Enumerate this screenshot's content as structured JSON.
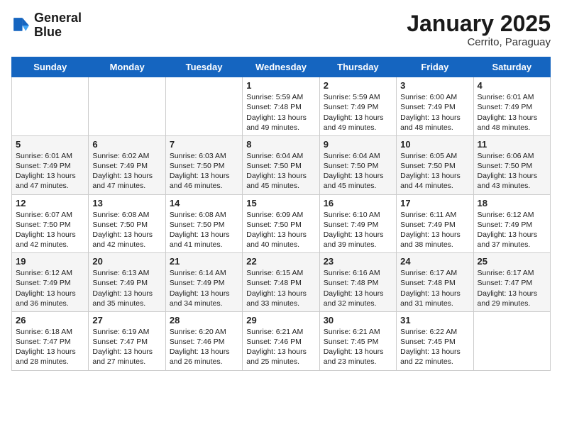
{
  "logo": {
    "line1": "General",
    "line2": "Blue"
  },
  "title": "January 2025",
  "subtitle": "Cerrito, Paraguay",
  "days_header": [
    "Sunday",
    "Monday",
    "Tuesday",
    "Wednesday",
    "Thursday",
    "Friday",
    "Saturday"
  ],
  "weeks": [
    [
      {
        "day": "",
        "content": ""
      },
      {
        "day": "",
        "content": ""
      },
      {
        "day": "",
        "content": ""
      },
      {
        "day": "1",
        "content": "Sunrise: 5:59 AM\nSunset: 7:48 PM\nDaylight: 13 hours\nand 49 minutes."
      },
      {
        "day": "2",
        "content": "Sunrise: 5:59 AM\nSunset: 7:49 PM\nDaylight: 13 hours\nand 49 minutes."
      },
      {
        "day": "3",
        "content": "Sunrise: 6:00 AM\nSunset: 7:49 PM\nDaylight: 13 hours\nand 48 minutes."
      },
      {
        "day": "4",
        "content": "Sunrise: 6:01 AM\nSunset: 7:49 PM\nDaylight: 13 hours\nand 48 minutes."
      }
    ],
    [
      {
        "day": "5",
        "content": "Sunrise: 6:01 AM\nSunset: 7:49 PM\nDaylight: 13 hours\nand 47 minutes."
      },
      {
        "day": "6",
        "content": "Sunrise: 6:02 AM\nSunset: 7:49 PM\nDaylight: 13 hours\nand 47 minutes."
      },
      {
        "day": "7",
        "content": "Sunrise: 6:03 AM\nSunset: 7:50 PM\nDaylight: 13 hours\nand 46 minutes."
      },
      {
        "day": "8",
        "content": "Sunrise: 6:04 AM\nSunset: 7:50 PM\nDaylight: 13 hours\nand 45 minutes."
      },
      {
        "day": "9",
        "content": "Sunrise: 6:04 AM\nSunset: 7:50 PM\nDaylight: 13 hours\nand 45 minutes."
      },
      {
        "day": "10",
        "content": "Sunrise: 6:05 AM\nSunset: 7:50 PM\nDaylight: 13 hours\nand 44 minutes."
      },
      {
        "day": "11",
        "content": "Sunrise: 6:06 AM\nSunset: 7:50 PM\nDaylight: 13 hours\nand 43 minutes."
      }
    ],
    [
      {
        "day": "12",
        "content": "Sunrise: 6:07 AM\nSunset: 7:50 PM\nDaylight: 13 hours\nand 42 minutes."
      },
      {
        "day": "13",
        "content": "Sunrise: 6:08 AM\nSunset: 7:50 PM\nDaylight: 13 hours\nand 42 minutes."
      },
      {
        "day": "14",
        "content": "Sunrise: 6:08 AM\nSunset: 7:50 PM\nDaylight: 13 hours\nand 41 minutes."
      },
      {
        "day": "15",
        "content": "Sunrise: 6:09 AM\nSunset: 7:50 PM\nDaylight: 13 hours\nand 40 minutes."
      },
      {
        "day": "16",
        "content": "Sunrise: 6:10 AM\nSunset: 7:49 PM\nDaylight: 13 hours\nand 39 minutes."
      },
      {
        "day": "17",
        "content": "Sunrise: 6:11 AM\nSunset: 7:49 PM\nDaylight: 13 hours\nand 38 minutes."
      },
      {
        "day": "18",
        "content": "Sunrise: 6:12 AM\nSunset: 7:49 PM\nDaylight: 13 hours\nand 37 minutes."
      }
    ],
    [
      {
        "day": "19",
        "content": "Sunrise: 6:12 AM\nSunset: 7:49 PM\nDaylight: 13 hours\nand 36 minutes."
      },
      {
        "day": "20",
        "content": "Sunrise: 6:13 AM\nSunset: 7:49 PM\nDaylight: 13 hours\nand 35 minutes."
      },
      {
        "day": "21",
        "content": "Sunrise: 6:14 AM\nSunset: 7:49 PM\nDaylight: 13 hours\nand 34 minutes."
      },
      {
        "day": "22",
        "content": "Sunrise: 6:15 AM\nSunset: 7:48 PM\nDaylight: 13 hours\nand 33 minutes."
      },
      {
        "day": "23",
        "content": "Sunrise: 6:16 AM\nSunset: 7:48 PM\nDaylight: 13 hours\nand 32 minutes."
      },
      {
        "day": "24",
        "content": "Sunrise: 6:17 AM\nSunset: 7:48 PM\nDaylight: 13 hours\nand 31 minutes."
      },
      {
        "day": "25",
        "content": "Sunrise: 6:17 AM\nSunset: 7:47 PM\nDaylight: 13 hours\nand 29 minutes."
      }
    ],
    [
      {
        "day": "26",
        "content": "Sunrise: 6:18 AM\nSunset: 7:47 PM\nDaylight: 13 hours\nand 28 minutes."
      },
      {
        "day": "27",
        "content": "Sunrise: 6:19 AM\nSunset: 7:47 PM\nDaylight: 13 hours\nand 27 minutes."
      },
      {
        "day": "28",
        "content": "Sunrise: 6:20 AM\nSunset: 7:46 PM\nDaylight: 13 hours\nand 26 minutes."
      },
      {
        "day": "29",
        "content": "Sunrise: 6:21 AM\nSunset: 7:46 PM\nDaylight: 13 hours\nand 25 minutes."
      },
      {
        "day": "30",
        "content": "Sunrise: 6:21 AM\nSunset: 7:45 PM\nDaylight: 13 hours\nand 23 minutes."
      },
      {
        "day": "31",
        "content": "Sunrise: 6:22 AM\nSunset: 7:45 PM\nDaylight: 13 hours\nand 22 minutes."
      },
      {
        "day": "",
        "content": ""
      }
    ]
  ]
}
